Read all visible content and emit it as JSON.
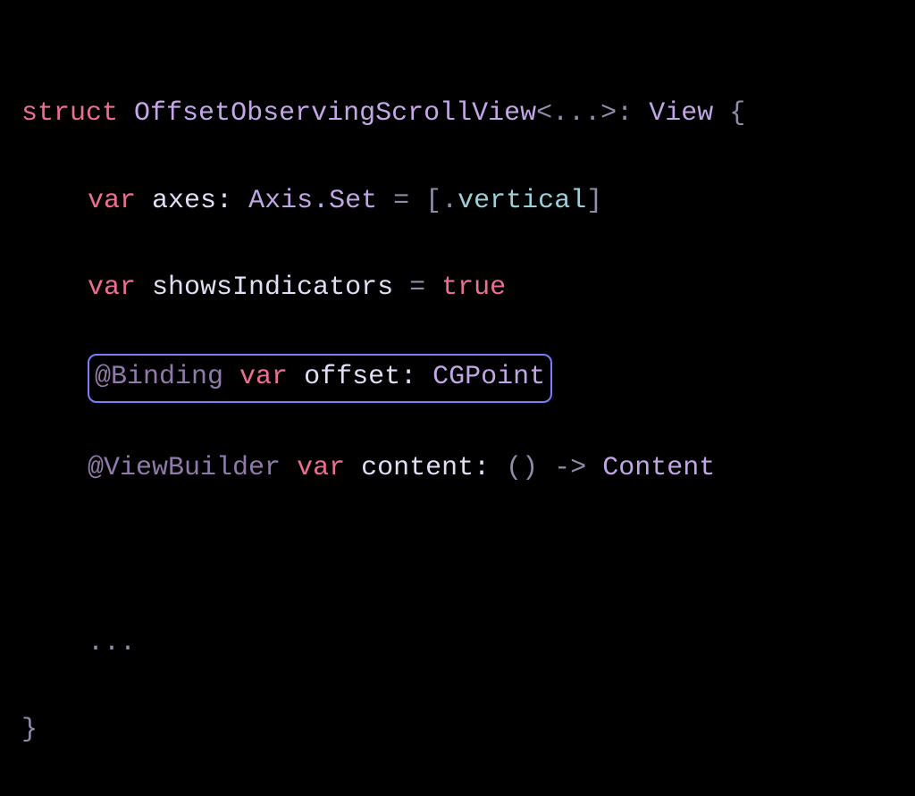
{
  "code": {
    "line1": {
      "struct_kw": "struct",
      "typename": "OffsetObservingScrollView",
      "generics_open": "<",
      "generics_inner": "...",
      "generics_close": ">:",
      "conforms": "View",
      "brace": "{"
    },
    "line2": {
      "var_kw": "var",
      "prop": "axes:",
      "type": "Axis.Set",
      "eq": "=",
      "bracket_open": "[",
      "dot": ".",
      "member": "vertical",
      "bracket_close": "]"
    },
    "line3": {
      "var_kw": "var",
      "prop": "showsIndicators",
      "eq": "=",
      "bool": "true"
    },
    "line4": {
      "attr": "@Binding",
      "var_kw": "var",
      "prop": "offset:",
      "type": "CGPoint"
    },
    "line5": {
      "attr": "@ViewBuilder",
      "var_kw": "var",
      "prop": "content:",
      "sig_open": "()",
      "arrow": "->",
      "rettype": "Content"
    },
    "line6": {
      "ellipsis": "..."
    },
    "line7": {
      "brace": "}"
    }
  }
}
